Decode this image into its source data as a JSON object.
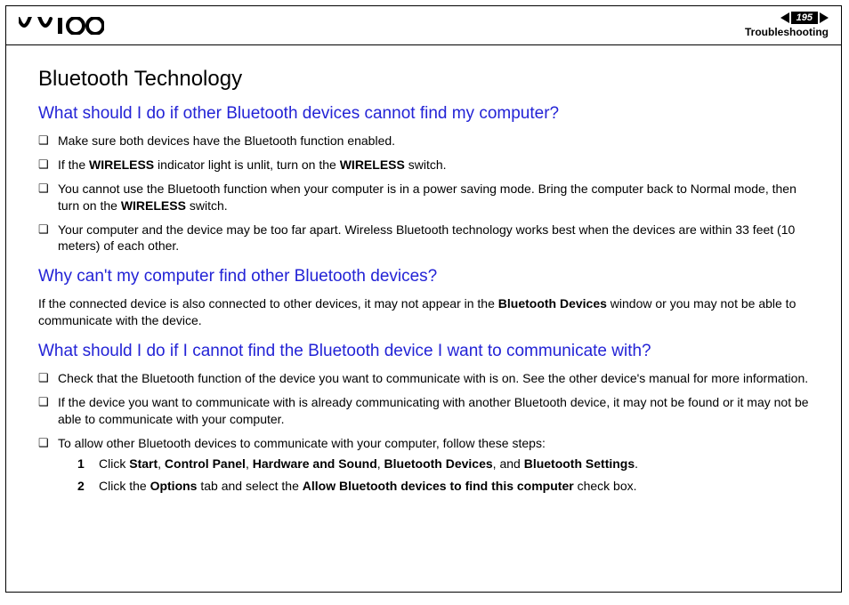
{
  "header": {
    "page_number": "195",
    "section": "Troubleshooting"
  },
  "title": "Bluetooth Technology",
  "sections": [
    {
      "question": "What should I do if other Bluetooth devices cannot find my computer?",
      "bullets": [
        {
          "pre": "Make sure both devices have the Bluetooth function enabled."
        },
        {
          "pre": "If the ",
          "b1": "WIRELESS",
          "mid": " indicator light is unlit, turn on the ",
          "b2": "WIRELESS",
          "post": " switch."
        },
        {
          "pre": "You cannot use the Bluetooth function when your computer is in a power saving mode. Bring the computer back to Normal mode, then turn on the ",
          "b1": "WIRELESS",
          "post": " switch."
        },
        {
          "pre": "Your computer and the device may be too far apart. Wireless Bluetooth technology works best when the devices are within 33 feet (10 meters) of each other."
        }
      ]
    },
    {
      "question": "Why can't my computer find other Bluetooth devices?",
      "paragraph": {
        "pre": "If the connected device is also connected to other devices, it may not appear in the ",
        "b1": "Bluetooth Devices",
        "post": " window or you may not be able to communicate with the device."
      }
    },
    {
      "question": "What should I do if I cannot find the Bluetooth device I want to communicate with?",
      "bullets": [
        {
          "pre": "Check that the Bluetooth function of the device you want to communicate with is on. See the other device's manual for more information."
        },
        {
          "pre": "If the device you want to communicate with is already communicating with another Bluetooth device, it may not be found or it may not be able to communicate with your computer."
        },
        {
          "pre": "To allow other Bluetooth devices to communicate with your computer, follow these steps:",
          "steps": [
            {
              "num": "1",
              "pre": "Click ",
              "b1": "Start",
              "s1": ", ",
              "b2": "Control Panel",
              "s2": ", ",
              "b3": "Hardware and Sound",
              "s3": ", ",
              "b4": "Bluetooth Devices",
              "s4": ", and ",
              "b5": "Bluetooth Settings",
              "post": "."
            },
            {
              "num": "2",
              "pre": "Click the ",
              "b1": "Options",
              "s1": " tab and select the ",
              "b2": "Allow Bluetooth devices to find this computer",
              "post": " check box."
            }
          ]
        }
      ]
    }
  ]
}
